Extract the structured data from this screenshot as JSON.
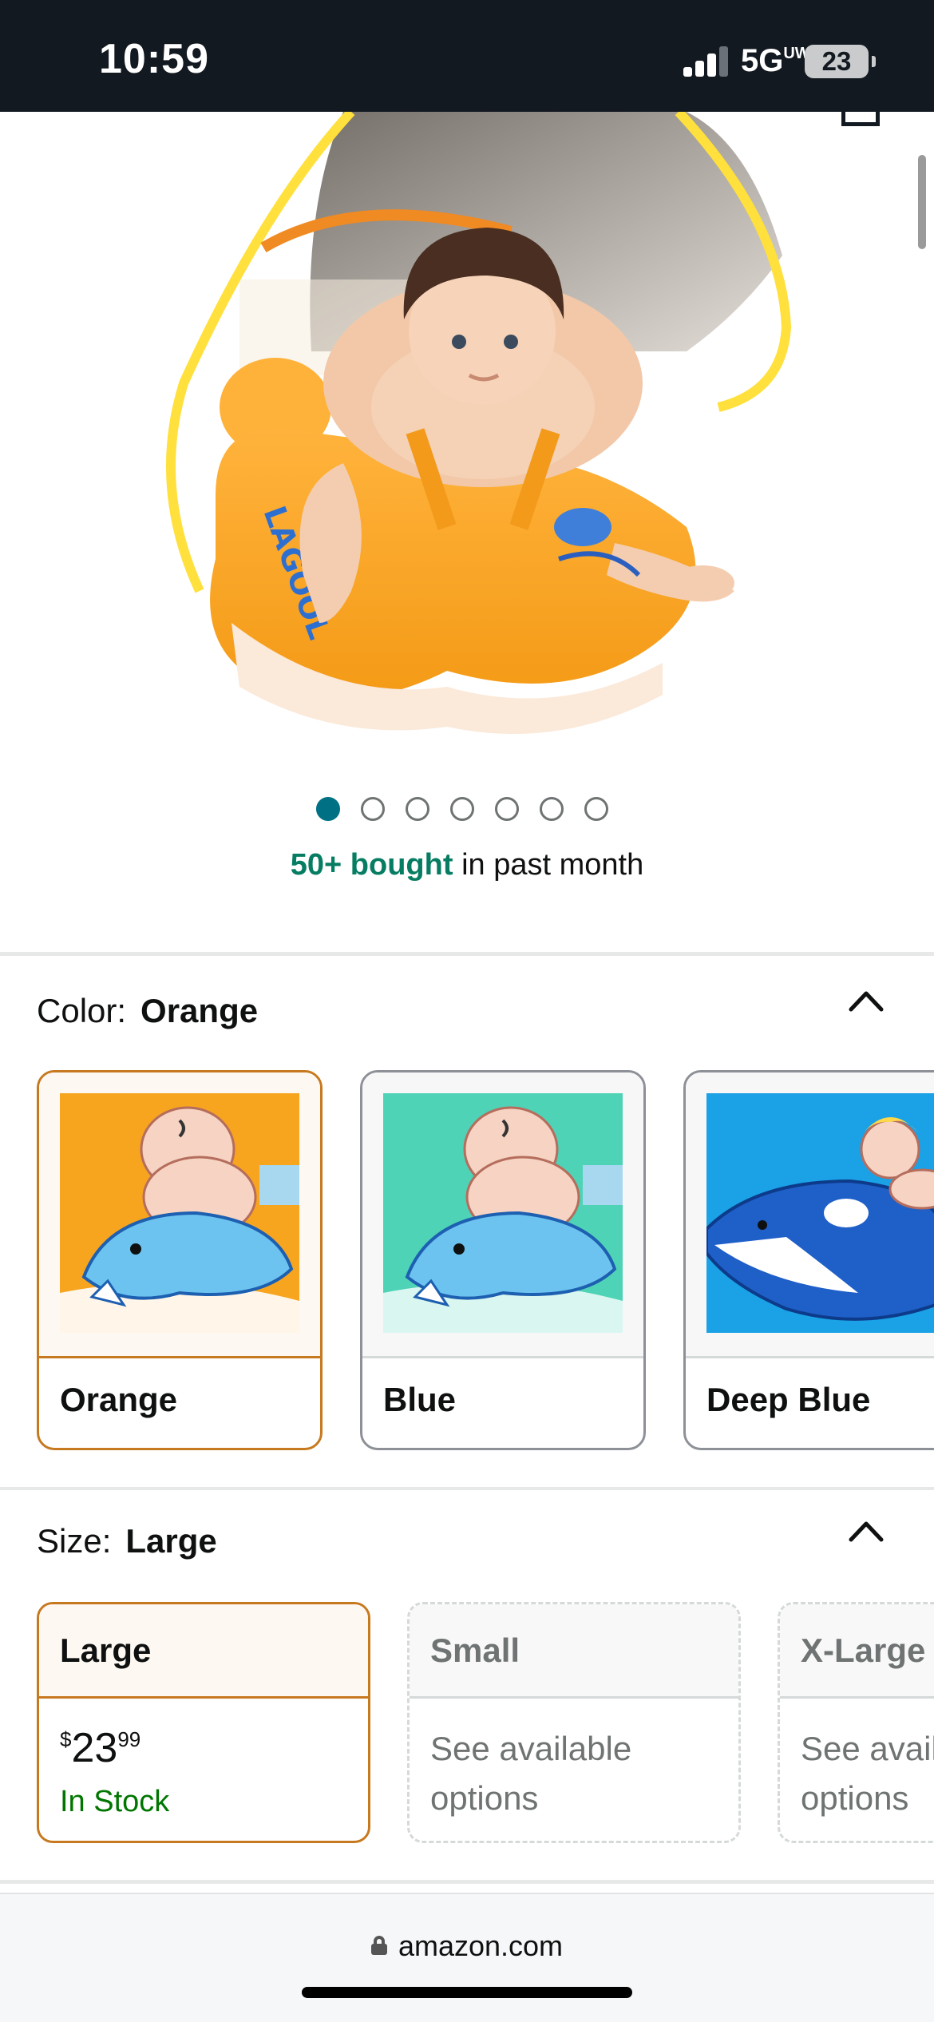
{
  "status_bar": {
    "time": "10:59",
    "network": "5G",
    "network_suffix": "UW",
    "battery": "23"
  },
  "product": {
    "image_icon": "product-photo-baby-swim-float-with-canopy",
    "carousel": {
      "total": 7,
      "active": 1
    },
    "bought_count": "50+ bought",
    "bought_suffix": " in past month",
    "wishlist_icon": "heart-outline-icon"
  },
  "color_section": {
    "label": "Color:",
    "selected_value": "Orange",
    "collapse_icon": "chevron-up-icon",
    "options": [
      {
        "name": "Orange",
        "selected": true,
        "background": "#f7a51f",
        "icon": "baby-on-dolphin-orange"
      },
      {
        "name": "Blue",
        "selected": false,
        "background": "#4fd3b7",
        "icon": "baby-on-dolphin-teal"
      },
      {
        "name": "Deep Blue",
        "selected": false,
        "background": "#1aa1e6",
        "icon": "baby-on-orca-blue"
      }
    ]
  },
  "size_section": {
    "label": "Size:",
    "selected_value": "Large",
    "collapse_icon": "chevron-up-icon",
    "options": [
      {
        "name": "Large",
        "price_symbol": "$",
        "price_whole": "23",
        "price_fraction": "99",
        "stock": "In Stock",
        "available": true
      },
      {
        "name": "Small",
        "availability_line1": "See available",
        "availability_line2": "options",
        "available": false
      },
      {
        "name": "X-Large",
        "availability_line1": "See available",
        "availability_line2": "options",
        "available": false
      }
    ]
  },
  "url_bar": {
    "domain": "amazon.com",
    "lock_icon": "lock-icon"
  },
  "colors": {
    "status_bar_bg": "#131921",
    "bought_green": "#067d62",
    "in_stock_green": "#007600",
    "selected_border": "#c7791f",
    "active_dot": "#007185"
  }
}
